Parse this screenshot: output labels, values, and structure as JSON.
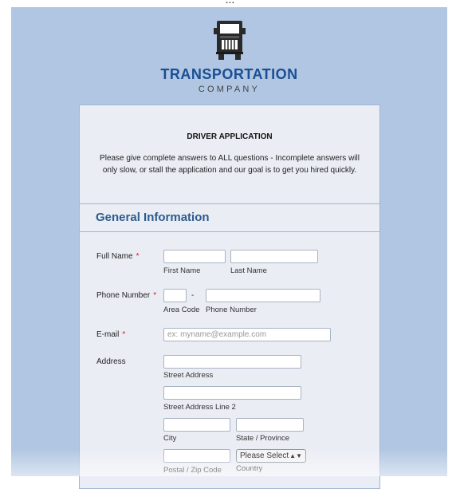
{
  "top_text": "...",
  "logo": {
    "name": "TRANSPORTATION",
    "sub": "COMPANY",
    "icon": "truck-icon"
  },
  "form": {
    "title": "DRIVER APPLICATION",
    "description": "Please give complete answers to ALL questions - Incomplete answers will only slow, or stall the application and our goal is to get you hired quickly.",
    "section": "General Information",
    "required_marker": "*",
    "full_name": {
      "label": "Full Name",
      "first": "First Name",
      "last": "Last Name"
    },
    "phone": {
      "label": "Phone Number",
      "dash": "-",
      "area": "Area Code",
      "number": "Phone Number"
    },
    "email": {
      "label": "E-mail",
      "placeholder": "ex: myname@example.com"
    },
    "address": {
      "label": "Address",
      "street": "Street Address",
      "street2": "Street Address Line 2",
      "city": "City",
      "state": "State / Province",
      "postal": "Postal / Zip Code",
      "country": "Country",
      "country_select": "Please Select"
    }
  },
  "colors": {
    "background": "#b0c6e2",
    "brand": "#1a4f93",
    "section_title": "#2c5c8f",
    "required": "#d02020"
  }
}
